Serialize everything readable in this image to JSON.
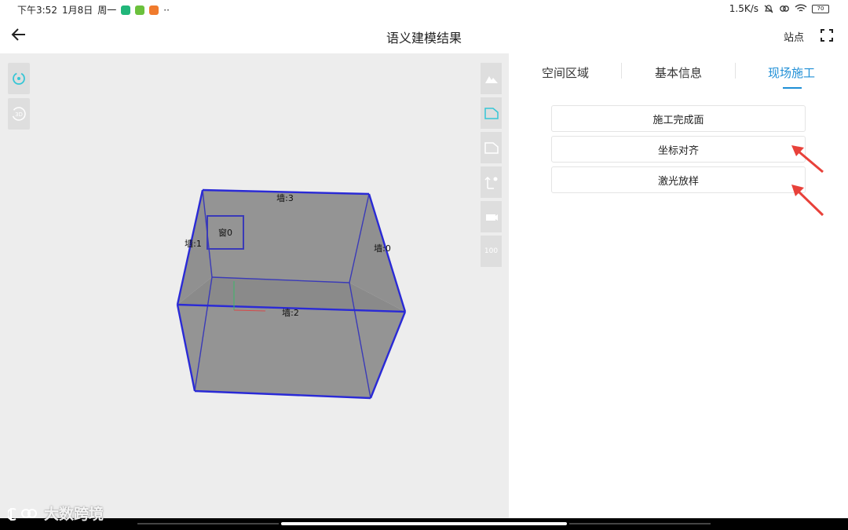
{
  "status_bar": {
    "time": "下午3:52",
    "date": "1月8日",
    "weekday": "周一",
    "more": "··",
    "net_speed": "1.5K/s",
    "battery": "70"
  },
  "app_bar": {
    "title": "语义建模结果",
    "station_label": "站点"
  },
  "viewport": {
    "labels": {
      "wall3": "墙:3",
      "wall1": "墙:1",
      "wall0": "墙:0",
      "wall2": "墙:2",
      "window0": "窗0"
    },
    "tool_scale_label": "100",
    "tool_3d_label": "3D"
  },
  "panel": {
    "tabs": [
      {
        "label": "空间区域",
        "active": false
      },
      {
        "label": "基本信息",
        "active": false
      },
      {
        "label": "现场施工",
        "active": true
      }
    ],
    "buttons": [
      {
        "label": "施工完成面"
      },
      {
        "label": "坐标对齐"
      },
      {
        "label": "激光放样"
      }
    ]
  },
  "watermark": {
    "text": "大数跨境"
  },
  "colors": {
    "accent": "#1f8fd6",
    "model_edge": "#2a2ad6",
    "annotation_arrow": "#e8413a"
  }
}
